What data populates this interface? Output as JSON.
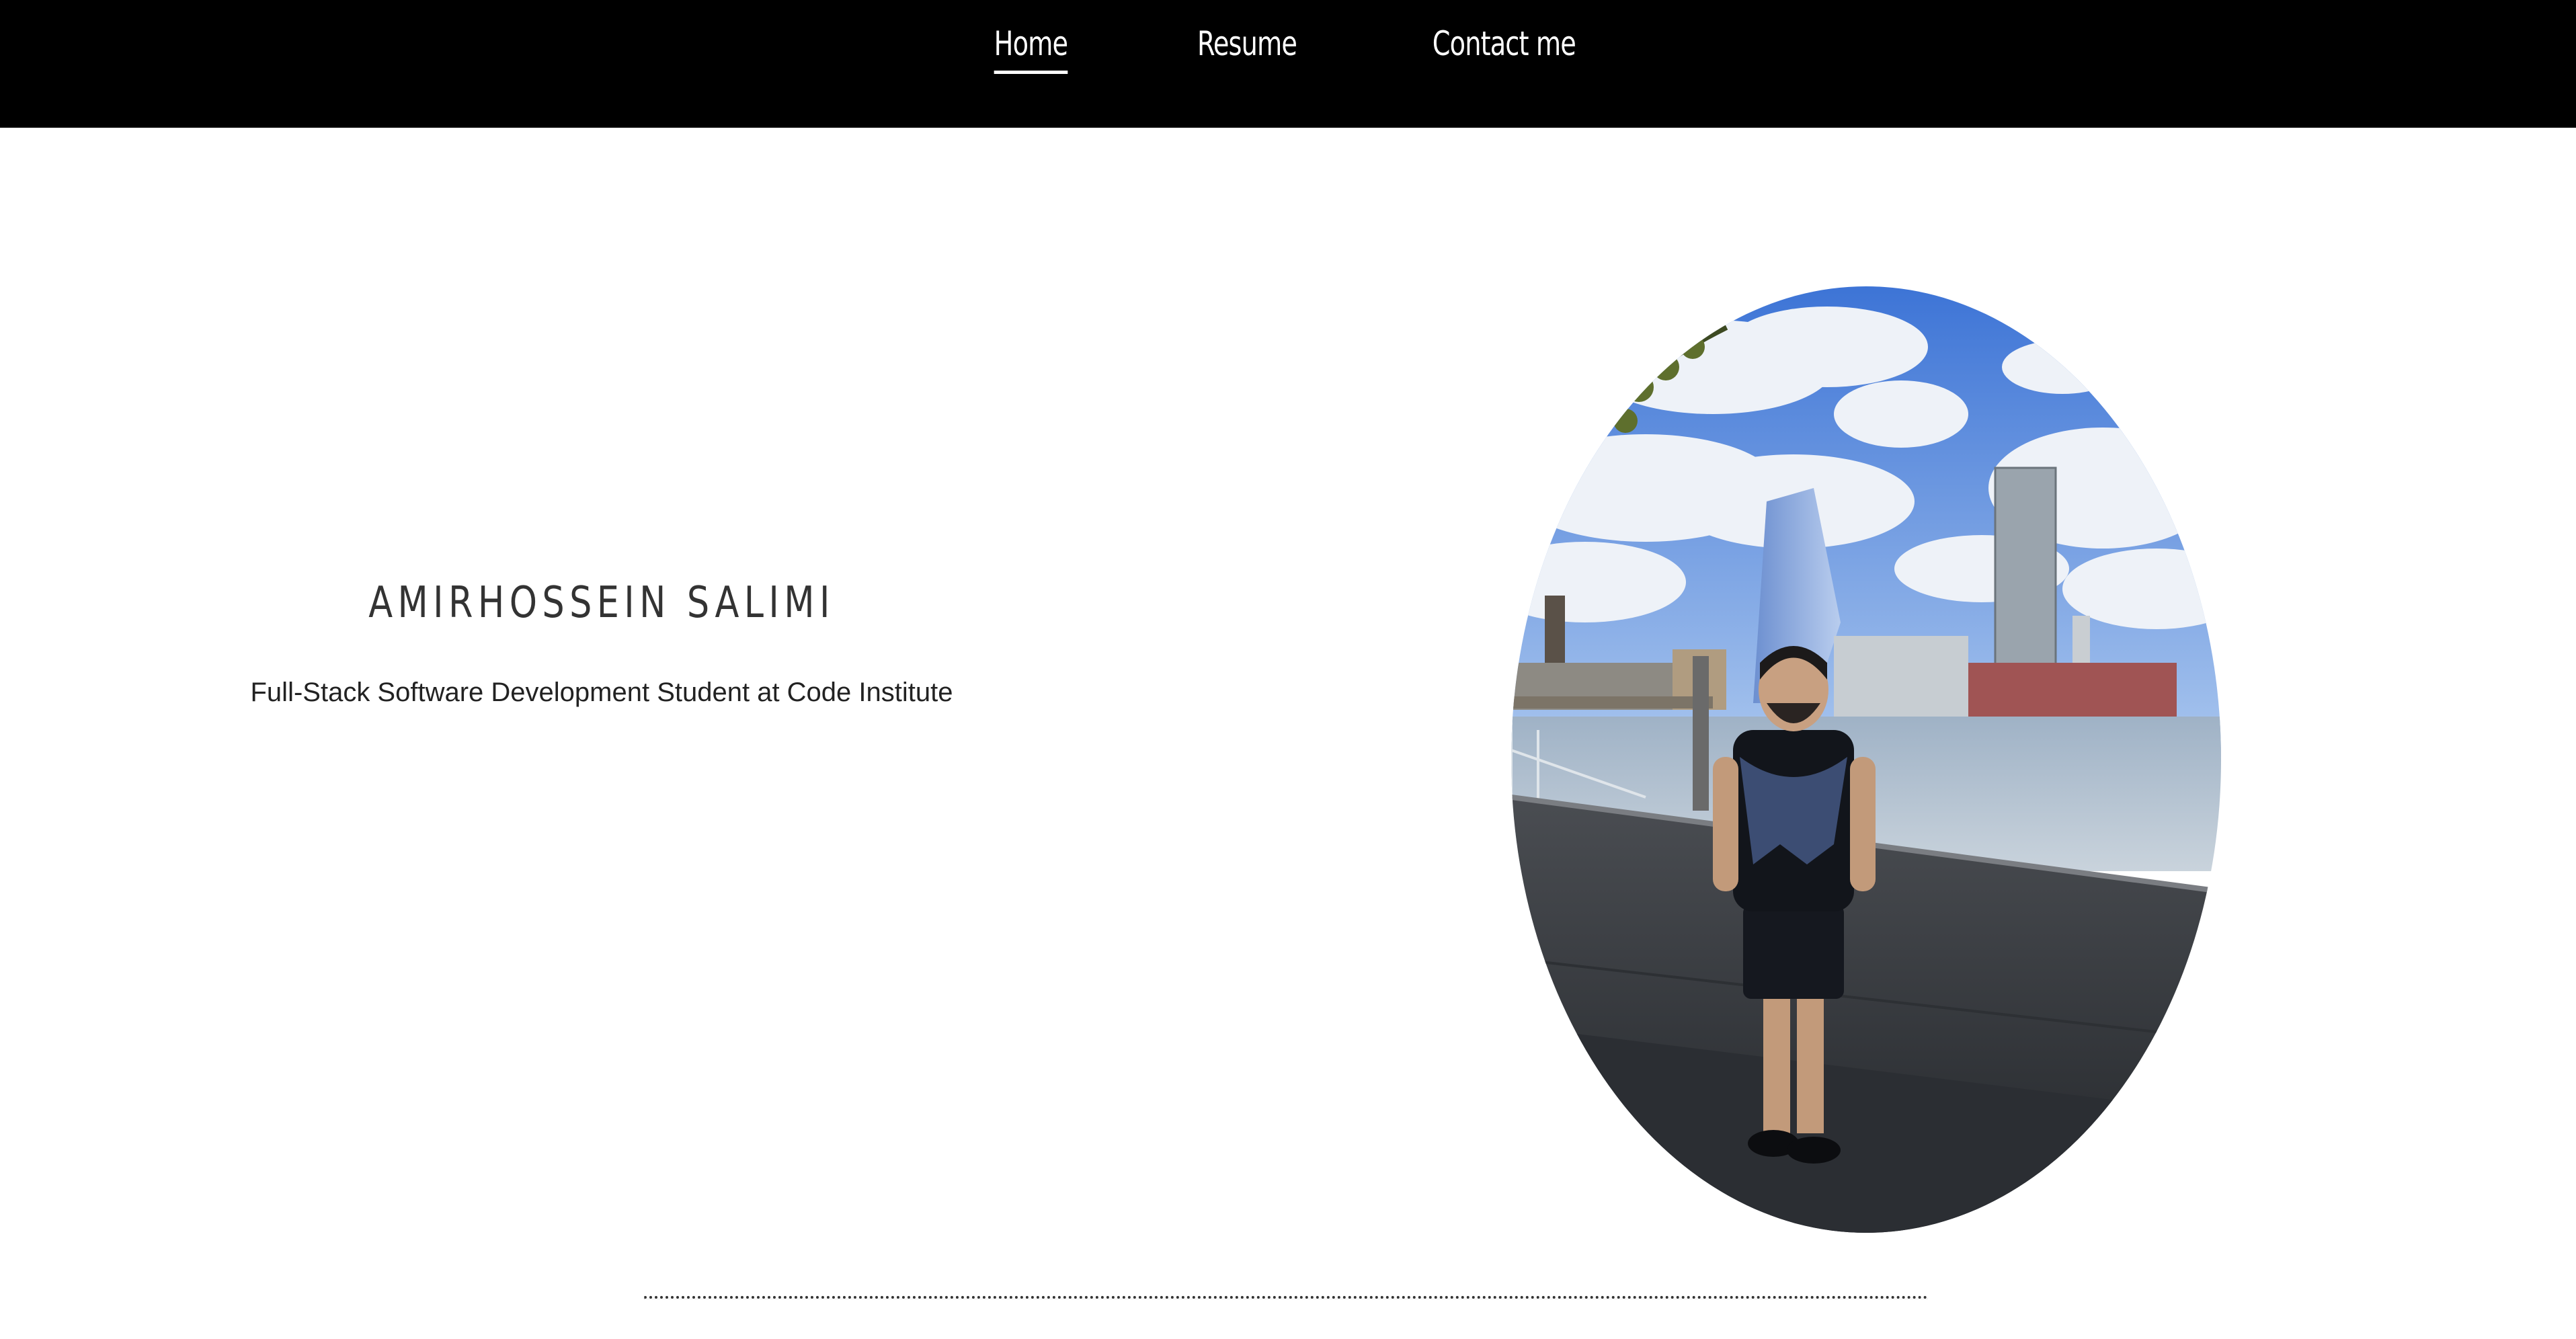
{
  "nav": {
    "items": [
      {
        "label": "Home",
        "active": true
      },
      {
        "label": "Resume",
        "active": false
      },
      {
        "label": "Contact me",
        "active": false
      }
    ]
  },
  "hero": {
    "name": "AMIRHOSSEIN SALIMI",
    "tagline": "Full-Stack Software Development Student at Code Institute"
  },
  "colors": {
    "nav_bg": "#000000",
    "nav_text": "#ffffff",
    "name_text": "#333333",
    "page_bg": "#ffffff"
  }
}
